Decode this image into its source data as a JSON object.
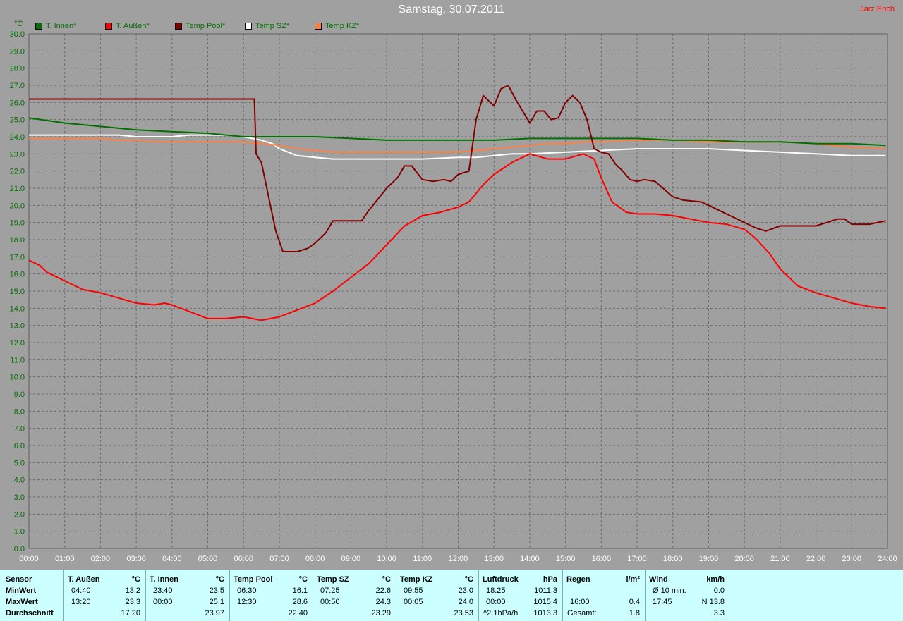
{
  "header": {
    "title": "Samstag, 30.07.2011",
    "author": "Jarz Erich"
  },
  "legend": [
    {
      "label": "T. Innen*",
      "color": "#007000",
      "text_color": "#007000"
    },
    {
      "label": "T. Außen*",
      "color": "#ff0000",
      "text_color": "#007000"
    },
    {
      "label": "Temp Pool*",
      "color": "#800000",
      "text_color": "#007000"
    },
    {
      "label": "Temp SZ*",
      "color": "#ffffff",
      "text_color": "#007000"
    },
    {
      "label": "Temp KZ*",
      "color": "#ff8040",
      "text_color": "#007000"
    }
  ],
  "chart_data": {
    "type": "line",
    "title": "Samstag, 30.07.2011",
    "ylabel": "°C",
    "xlabel": "",
    "ylim": [
      0,
      30
    ],
    "xlim": [
      0,
      24
    ],
    "grid": true,
    "legend_position": "top-left",
    "yticks": [
      "0.0",
      "1.0",
      "2.0",
      "3.0",
      "4.0",
      "5.0",
      "6.0",
      "7.0",
      "8.0",
      "9.0",
      "10.0",
      "11.0",
      "12.0",
      "13.0",
      "14.0",
      "15.0",
      "16.0",
      "17.0",
      "18.0",
      "19.0",
      "20.0",
      "21.0",
      "22.0",
      "23.0",
      "24.0",
      "25.0",
      "26.0",
      "27.0",
      "28.0",
      "29.0",
      "30.0"
    ],
    "xticks": [
      "00:00",
      "01:00",
      "02:00",
      "03:00",
      "04:00",
      "05:00",
      "06:00",
      "07:00",
      "08:00",
      "09:00",
      "10:00",
      "11:00",
      "12:00",
      "13:00",
      "14:00",
      "15:00",
      "16:00",
      "17:00",
      "18:00",
      "19:00",
      "20:00",
      "21:00",
      "22:00",
      "23:00",
      "24:00"
    ],
    "series": [
      {
        "name": "T. Innen*",
        "color": "#007000",
        "x": [
          0,
          1,
          2,
          3,
          4,
          5,
          6,
          7,
          8,
          9,
          10,
          11,
          12,
          13,
          14,
          15,
          16,
          17,
          18,
          19,
          20,
          21,
          22,
          23,
          23.95
        ],
        "y": [
          25.1,
          24.8,
          24.6,
          24.4,
          24.3,
          24.2,
          24.0,
          24.0,
          24.0,
          23.9,
          23.8,
          23.8,
          23.8,
          23.8,
          23.9,
          23.9,
          23.9,
          23.9,
          23.8,
          23.8,
          23.7,
          23.7,
          23.6,
          23.6,
          23.5
        ]
      },
      {
        "name": "T. Außen*",
        "color": "#ff0000",
        "x": [
          0,
          0.3,
          0.5,
          1,
          1.5,
          2,
          2.5,
          3,
          3.5,
          3.8,
          4,
          4.5,
          5,
          5.5,
          6,
          6.5,
          7,
          7.5,
          8,
          8.5,
          9,
          9.5,
          10,
          10.5,
          11,
          11.5,
          12,
          12.3,
          12.7,
          13,
          13.5,
          14,
          14.5,
          15,
          15.5,
          15.8,
          16,
          16.3,
          16.7,
          17,
          17.5,
          18,
          18.5,
          19,
          19.5,
          20,
          20.3,
          20.7,
          21,
          21.5,
          22,
          22.5,
          23,
          23.5,
          23.95
        ],
        "y": [
          16.8,
          16.5,
          16.1,
          15.6,
          15.1,
          14.9,
          14.6,
          14.3,
          14.2,
          14.3,
          14.2,
          13.8,
          13.4,
          13.4,
          13.5,
          13.3,
          13.5,
          13.9,
          14.3,
          15.0,
          15.8,
          16.6,
          17.7,
          18.8,
          19.4,
          19.6,
          19.9,
          20.2,
          21.2,
          21.8,
          22.5,
          23.0,
          22.7,
          22.7,
          23.0,
          22.7,
          21.6,
          20.2,
          19.6,
          19.5,
          19.5,
          19.4,
          19.2,
          19.0,
          18.9,
          18.6,
          18.1,
          17.2,
          16.3,
          15.3,
          14.9,
          14.6,
          14.3,
          14.1,
          14.0
        ]
      },
      {
        "name": "Temp Pool*",
        "color": "#800000",
        "x": [
          0,
          0.5,
          1,
          2,
          3,
          4,
          5,
          6,
          6.3,
          6.35,
          6.5,
          6.7,
          6.9,
          7.1,
          7.5,
          7.8,
          8,
          8.3,
          8.5,
          9,
          9.3,
          9.5,
          10,
          10.3,
          10.5,
          10.7,
          11,
          11.3,
          11.6,
          11.8,
          12,
          12.3,
          12.5,
          12.7,
          13,
          13.2,
          13.4,
          13.6,
          13.8,
          14,
          14.2,
          14.4,
          14.6,
          14.8,
          15,
          15.2,
          15.4,
          15.6,
          15.8,
          16,
          16.2,
          16.4,
          16.6,
          16.8,
          17,
          17.2,
          17.5,
          18,
          18.3,
          18.8,
          19,
          19.5,
          20,
          20.3,
          20.6,
          21,
          21.5,
          22,
          22.3,
          22.6,
          22.8,
          23,
          23.5,
          23.95
        ],
        "y": [
          26.2,
          26.2,
          26.2,
          26.2,
          26.2,
          26.2,
          26.2,
          26.2,
          26.2,
          23.0,
          22.5,
          20.5,
          18.5,
          17.3,
          17.3,
          17.5,
          17.8,
          18.4,
          19.1,
          19.1,
          19.1,
          19.7,
          21.0,
          21.6,
          22.3,
          22.3,
          21.5,
          21.4,
          21.5,
          21.4,
          21.8,
          22.0,
          25.0,
          26.4,
          25.8,
          26.8,
          27.0,
          26.2,
          25.5,
          24.8,
          25.5,
          25.5,
          25.0,
          25.1,
          26.0,
          26.4,
          26.0,
          25.0,
          23.3,
          23.1,
          23.0,
          22.4,
          22.0,
          21.5,
          21.4,
          21.5,
          21.4,
          20.5,
          20.3,
          20.2,
          20.0,
          19.5,
          19.0,
          18.7,
          18.5,
          18.8,
          18.8,
          18.8,
          19.0,
          19.2,
          19.2,
          18.9,
          18.9,
          19.1
        ]
      },
      {
        "name": "Temp SZ*",
        "color": "#ffffff",
        "x": [
          0,
          0.5,
          1,
          1.5,
          2,
          2.5,
          3,
          3.5,
          4,
          4.5,
          5,
          5.5,
          6,
          6.5,
          6.8,
          7,
          7.5,
          8,
          8.5,
          9,
          9.5,
          10,
          11,
          12,
          12.5,
          13,
          13.5,
          14,
          15,
          16,
          17,
          18,
          19,
          20,
          21,
          22,
          23,
          23.95
        ],
        "y": [
          24.1,
          24.1,
          24.1,
          24.1,
          24.1,
          24.1,
          24.0,
          24.0,
          24.0,
          24.1,
          24.1,
          24.1,
          24.0,
          23.8,
          23.6,
          23.3,
          22.9,
          22.8,
          22.7,
          22.7,
          22.7,
          22.7,
          22.7,
          22.8,
          22.8,
          22.9,
          23.0,
          23.0,
          23.1,
          23.2,
          23.3,
          23.3,
          23.3,
          23.2,
          23.1,
          23.0,
          22.9,
          22.9
        ]
      },
      {
        "name": "Temp KZ*",
        "color": "#ff8040",
        "x": [
          0,
          0.5,
          1,
          1.5,
          2,
          2.5,
          3,
          3.5,
          4,
          4.5,
          5,
          5.5,
          6,
          6.5,
          7,
          7.5,
          8,
          8.5,
          9,
          10,
          11,
          12,
          12.5,
          13,
          13.5,
          14,
          14.5,
          15,
          15.5,
          16,
          17,
          18,
          19,
          20,
          21,
          22,
          23,
          23.95
        ],
        "y": [
          23.9,
          23.9,
          23.9,
          23.9,
          23.9,
          23.8,
          23.8,
          23.7,
          23.7,
          23.7,
          23.7,
          23.7,
          23.7,
          23.6,
          23.5,
          23.3,
          23.2,
          23.1,
          23.1,
          23.1,
          23.1,
          23.1,
          23.2,
          23.3,
          23.4,
          23.5,
          23.6,
          23.6,
          23.7,
          23.7,
          23.8,
          23.8,
          23.7,
          23.7,
          23.7,
          23.6,
          23.4,
          23.3
        ]
      }
    ]
  },
  "table": {
    "row_labels": [
      "Sensor",
      "MinWert",
      "MaxWert",
      "Durchschnitt"
    ],
    "columns": [
      {
        "name": "T. Außen",
        "unit": "°C",
        "min_time": "04:40",
        "min_val": "13.2",
        "max_time": "13:20",
        "max_val": "23.3",
        "avg_label": "",
        "avg": "17.20"
      },
      {
        "name": "T. Innen",
        "unit": "°C",
        "min_time": "23:40",
        "min_val": "23.5",
        "max_time": "00:00",
        "max_val": "25.1",
        "avg_label": "",
        "avg": "23.97"
      },
      {
        "name": "Temp Pool",
        "unit": "°C",
        "min_time": "06:30",
        "min_val": "16.1",
        "max_time": "12:30",
        "max_val": "28.6",
        "avg_label": "",
        "avg": "22.40"
      },
      {
        "name": "Temp SZ",
        "unit": "°C",
        "min_time": "07:25",
        "min_val": "22.6",
        "max_time": "00:50",
        "max_val": "24.3",
        "avg_label": "",
        "avg": "23.29"
      },
      {
        "name": "Temp KZ",
        "unit": "°C",
        "min_time": "09:55",
        "min_val": "23.0",
        "max_time": "00:05",
        "max_val": "24.0",
        "avg_label": "",
        "avg": "23.53"
      },
      {
        "name": "Luftdruck",
        "unit": "hPa",
        "min_time": "18:25",
        "min_val": "1011.3",
        "max_time": "00:00",
        "max_val": "1015.4",
        "avg_label": "^2.1hPa/h",
        "avg": "1013.3"
      },
      {
        "name": "Regen",
        "unit": "l/m²",
        "min_time": "",
        "min_val": "",
        "max_time": "16:00",
        "max_val": "0.4",
        "avg_label": "Gesamt:",
        "avg": "1.8"
      },
      {
        "name": "Wind",
        "unit": "km/h",
        "min_time": "Ø 10 min.",
        "min_val": "0.0",
        "max_time": "17:45",
        "max_val": "N 13.8",
        "avg_label": "",
        "avg": "3.3"
      }
    ]
  }
}
